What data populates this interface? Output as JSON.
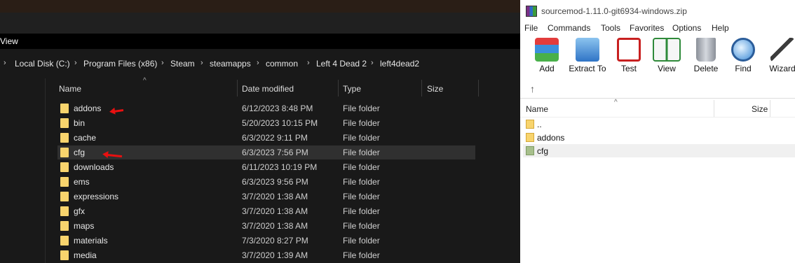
{
  "explorer": {
    "menu_view": "View",
    "breadcrumb": [
      "Local Disk (C:)",
      "Program Files (x86)",
      "Steam",
      "steamapps",
      "common",
      "Left 4 Dead 2",
      "left4dead2"
    ],
    "columns": {
      "name": "Name",
      "date": "Date modified",
      "type": "Type",
      "size": "Size"
    },
    "rows": [
      {
        "name": "addons",
        "date": "6/12/2023 8:48 PM",
        "type": "File folder"
      },
      {
        "name": "bin",
        "date": "5/20/2023 10:15 PM",
        "type": "File folder"
      },
      {
        "name": "cache",
        "date": "6/3/2022 9:11 PM",
        "type": "File folder"
      },
      {
        "name": "cfg",
        "date": "6/3/2023 7:56 PM",
        "type": "File folder"
      },
      {
        "name": "downloads",
        "date": "6/11/2023 10:19 PM",
        "type": "File folder"
      },
      {
        "name": "ems",
        "date": "6/3/2023 9:56 PM",
        "type": "File folder"
      },
      {
        "name": "expressions",
        "date": "3/7/2020 1:38 AM",
        "type": "File folder"
      },
      {
        "name": "gfx",
        "date": "3/7/2020 1:38 AM",
        "type": "File folder"
      },
      {
        "name": "maps",
        "date": "3/7/2020 1:38 AM",
        "type": "File folder"
      },
      {
        "name": "materials",
        "date": "7/3/2020 8:27 PM",
        "type": "File folder"
      },
      {
        "name": "media",
        "date": "3/7/2020 1:39 AM",
        "type": "File folder"
      }
    ]
  },
  "winrar": {
    "title": "sourcemod-1.11.0-git6934-windows.zip",
    "menu": [
      "File",
      "Commands",
      "Tools",
      "Favorites",
      "Options",
      "Help"
    ],
    "tools": [
      {
        "label": "Add",
        "icon": "add-archive-icon"
      },
      {
        "label": "Extract To",
        "icon": "extract-to-icon"
      },
      {
        "label": "Test",
        "icon": "test-icon"
      },
      {
        "label": "View",
        "icon": "view-icon"
      },
      {
        "label": "Delete",
        "icon": "delete-icon"
      },
      {
        "label": "Find",
        "icon": "find-icon"
      },
      {
        "label": "Wizard",
        "icon": "wizard-icon"
      }
    ],
    "columns": {
      "name": "Name",
      "size": "Size"
    },
    "rows": [
      {
        "name": ".."
      },
      {
        "name": "addons"
      },
      {
        "name": "cfg"
      }
    ]
  },
  "colors": {
    "folder": "#f8d46d",
    "annotation_arrow": "#e81010"
  }
}
